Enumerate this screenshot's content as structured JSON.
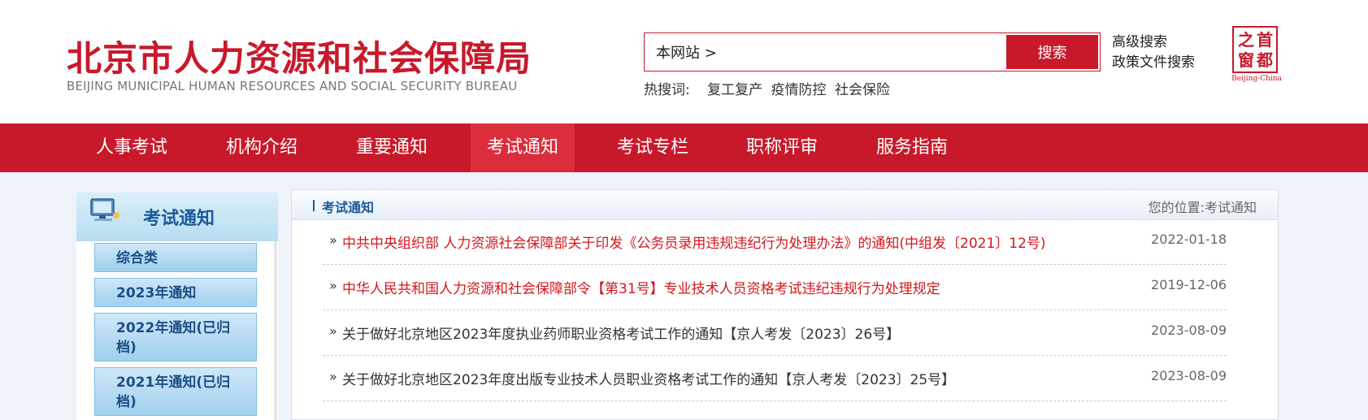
{
  "header": {
    "site_title": "北京市人力资源和社会保障局",
    "site_subtitle": "BEIJING MUNICIPAL HUMAN RESOURCES AND SOCIAL SECURITY BUREAU",
    "search_scope": "本网站 >",
    "search_button": "搜索",
    "hot_label": "热搜词:",
    "hot_keywords": [
      "复工复产",
      "疫情防控",
      "社会保险"
    ],
    "advanced_search": "高级搜索",
    "policy_search": "政策文件搜索",
    "seal": {
      "chars": [
        "首",
        "都",
        "之",
        "窗"
      ],
      "en": "Beijing-China"
    }
  },
  "nav": {
    "items": [
      {
        "label": "人事考试"
      },
      {
        "label": "机构介绍"
      },
      {
        "label": "重要通知"
      },
      {
        "label": "考试通知"
      },
      {
        "label": "考试专栏"
      },
      {
        "label": "职称评审"
      },
      {
        "label": "服务指南"
      }
    ],
    "active_index": 3
  },
  "sidebar": {
    "title": "考试通知",
    "items": [
      {
        "label": "综合类"
      },
      {
        "label": "2023年通知"
      },
      {
        "label": "2022年通知(已归档)"
      },
      {
        "label": "2021年通知(已归档)"
      }
    ]
  },
  "main": {
    "title": "考试通知",
    "location": "您的位置:考试通知",
    "arrow_glyph": "»",
    "notices": [
      {
        "title": "中共中央组织部 人力资源社会保障部关于印发《公务员录用违规违纪行为处理办法》的通知(中组发〔2021〕12号)",
        "date": "2022-01-18",
        "highlight": true
      },
      {
        "title": "中华人民共和国人力资源和社会保障部令【第31号】专业技术人员资格考试违纪违规行为处理规定",
        "date": "2019-12-06",
        "highlight": true
      },
      {
        "title": "关于做好北京地区2023年度执业药师职业资格考试工作的通知【京人考发〔2023〕26号】",
        "date": "2023-08-09",
        "highlight": false
      },
      {
        "title": "关于做好北京地区2023年度出版专业技术人员职业资格考试工作的通知【京人考发〔2023〕25号】",
        "date": "2023-08-09",
        "highlight": false
      }
    ]
  },
  "colors": {
    "brand_red": "#c8192b",
    "notice_red": "#d4161c",
    "sidebar_blue": "#1b5a9a"
  }
}
